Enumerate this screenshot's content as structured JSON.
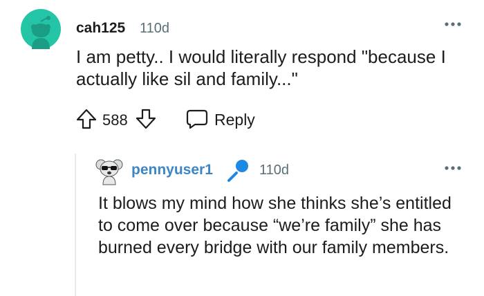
{
  "comment": {
    "username": "cah125",
    "time": "110d",
    "body": "I am petty.. I would literally respond \"because I actually like sil and family...\"",
    "score": "588",
    "reply_label": "Reply",
    "avatar_color": "#24c4a6"
  },
  "reply": {
    "username": "pennyuser1",
    "time": "110d",
    "body": "It blows my mind how she thinks she’s entitled to come over because “we’re family” she has burned every bridge with our family members.",
    "username_color": "#3d86c6",
    "mic_color": "#1e88e5"
  },
  "icons": {
    "more": "more-horizontal-icon",
    "upvote": "upvote-arrow-icon",
    "downvote": "downvote-arrow-icon",
    "reply": "reply-bubble-icon",
    "mic": "microphone-icon"
  }
}
